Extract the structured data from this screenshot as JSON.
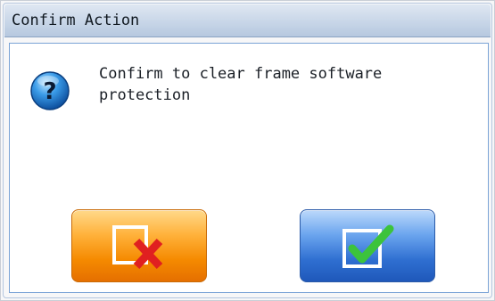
{
  "dialog": {
    "title": "Confirm Action",
    "message": "Confirm to clear frame software\nprotection",
    "icon": "question-icon",
    "cancel_icon": "cancel-x-icon",
    "confirm_icon": "confirm-check-icon",
    "colors": {
      "cancel_button": "#f58a00",
      "confirm_button": "#2f6fd1",
      "x_mark": "#e02020",
      "check_mark": "#3cc33c",
      "question_icon": "#1c7fd9"
    }
  }
}
